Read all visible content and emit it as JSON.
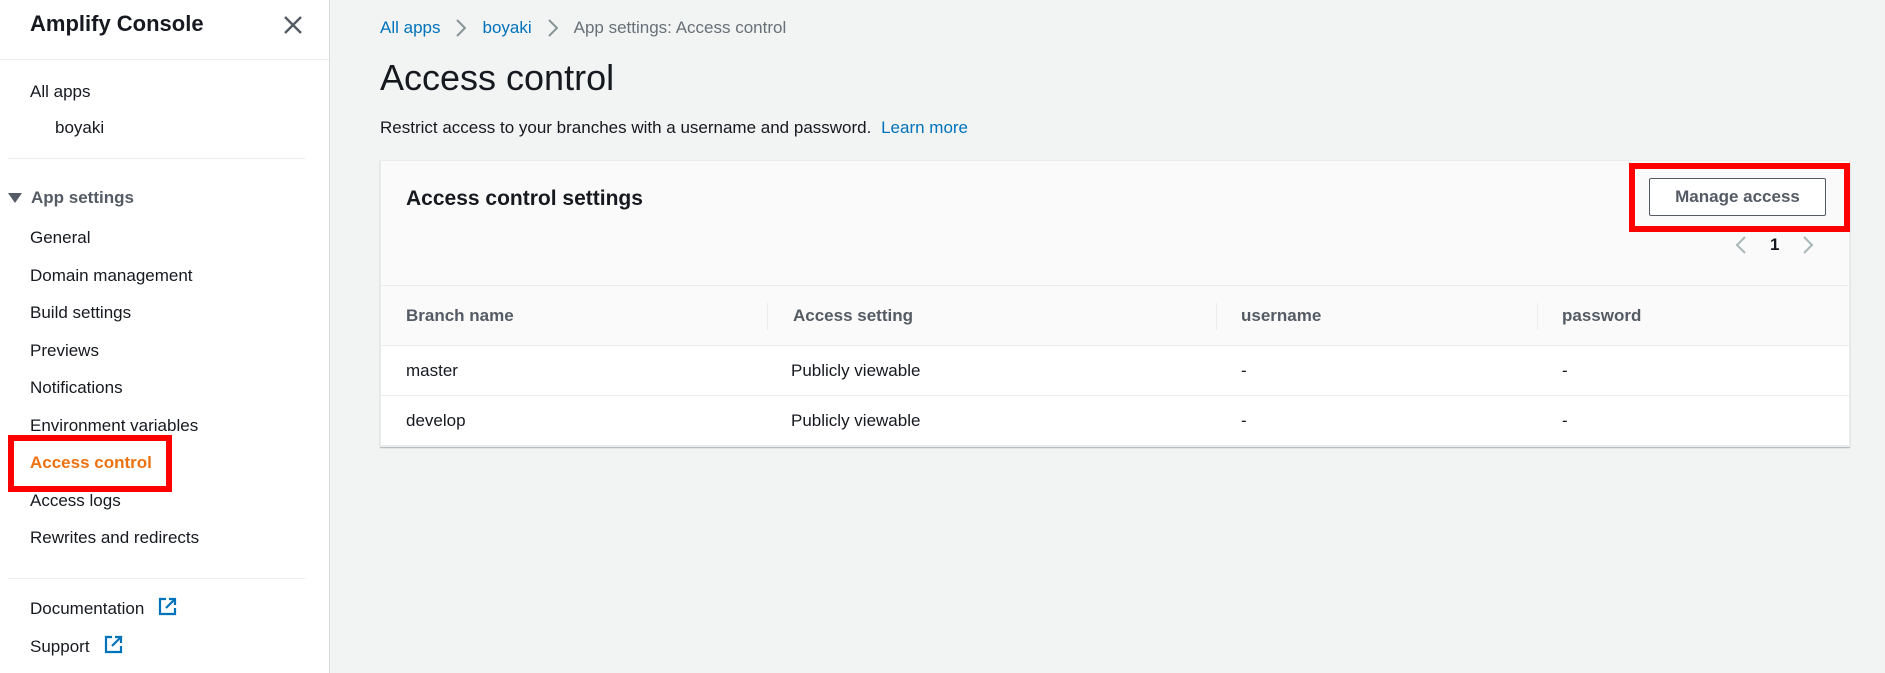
{
  "sidebar": {
    "title": "Amplify Console",
    "all_apps": "All apps",
    "app_name": "boyaki",
    "section_label": "App settings",
    "items": [
      {
        "label": "General"
      },
      {
        "label": "Domain management"
      },
      {
        "label": "Build settings"
      },
      {
        "label": "Previews"
      },
      {
        "label": "Notifications"
      },
      {
        "label": "Environment variables"
      },
      {
        "label": "Access control",
        "active": true
      },
      {
        "label": "Access logs"
      },
      {
        "label": "Rewrites and redirects"
      }
    ],
    "footer": [
      {
        "label": "Documentation",
        "icon": "external-link-icon"
      },
      {
        "label": "Support",
        "icon": "external-link-icon"
      }
    ]
  },
  "breadcrumb": {
    "items": [
      "All apps",
      "boyaki"
    ],
    "current": "App settings: Access control"
  },
  "main": {
    "title": "Access control",
    "description": "Restrict access to your branches with a username and password.",
    "learn_more": "Learn more"
  },
  "panel": {
    "title": "Access control settings",
    "manage_button": "Manage access",
    "page": "1"
  },
  "table": {
    "columns": [
      "Branch name",
      "Access setting",
      "username",
      "password"
    ],
    "rows": [
      [
        "master",
        "Publicly viewable",
        "-",
        "-"
      ],
      [
        "develop",
        "Publicly viewable",
        "-",
        "-"
      ]
    ]
  },
  "colors": {
    "accent_active": "#ec7211",
    "link": "#0073bb",
    "highlight": "#ff0000"
  }
}
